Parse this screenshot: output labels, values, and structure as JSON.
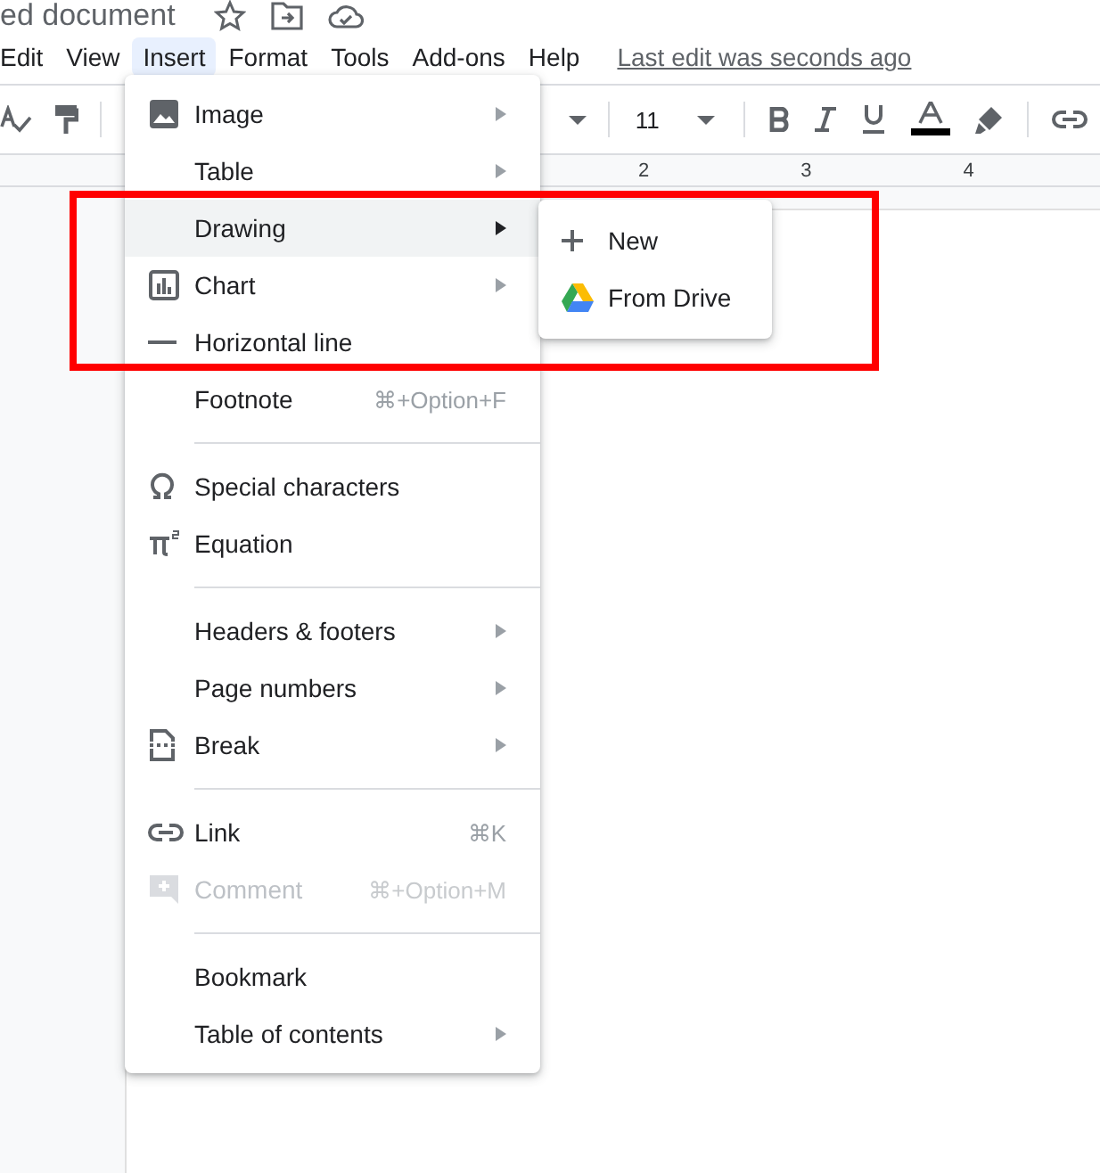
{
  "document_title": "ed document",
  "menu_bar": [
    {
      "label": "Edit",
      "selected": false
    },
    {
      "label": "View",
      "selected": false
    },
    {
      "label": "Insert",
      "selected": true
    },
    {
      "label": "Format",
      "selected": false
    },
    {
      "label": "Tools",
      "selected": false
    },
    {
      "label": "Add-ons",
      "selected": false
    },
    {
      "label": "Help",
      "selected": false
    }
  ],
  "last_edit": "Last edit was seconds ago",
  "toolbar": {
    "font_size": "11"
  },
  "ruler": [
    "2",
    "3",
    "4"
  ],
  "insert_menu": [
    {
      "kind": "image",
      "label": "Image",
      "submenu": true,
      "selected": false,
      "disabled": false
    },
    {
      "kind": "plain",
      "label": "Table",
      "submenu": true,
      "selected": false,
      "disabled": false
    },
    {
      "kind": "plain",
      "label": "Drawing",
      "submenu": true,
      "selected": true,
      "disabled": false
    },
    {
      "kind": "chart",
      "label": "Chart",
      "submenu": true,
      "selected": false,
      "disabled": false
    },
    {
      "kind": "line",
      "label": "Horizontal line",
      "submenu": false,
      "selected": false,
      "disabled": false
    },
    {
      "kind": "plain",
      "label": "Footnote",
      "shortcut": "⌘+Option+F",
      "submenu": false,
      "selected": false,
      "disabled": false
    },
    {
      "kind": "separator"
    },
    {
      "kind": "omega",
      "label": "Special characters",
      "submenu": false,
      "selected": false,
      "disabled": false
    },
    {
      "kind": "pi",
      "label": "Equation",
      "submenu": false,
      "selected": false,
      "disabled": false
    },
    {
      "kind": "separator"
    },
    {
      "kind": "plain",
      "label": "Headers & footers",
      "submenu": true,
      "selected": false,
      "disabled": false
    },
    {
      "kind": "plain",
      "label": "Page numbers",
      "submenu": true,
      "selected": false,
      "disabled": false
    },
    {
      "kind": "break",
      "label": "Break",
      "submenu": true,
      "selected": false,
      "disabled": false
    },
    {
      "kind": "separator"
    },
    {
      "kind": "link",
      "label": "Link",
      "shortcut": "⌘K",
      "submenu": false,
      "selected": false,
      "disabled": false
    },
    {
      "kind": "comment",
      "label": "Comment",
      "shortcut": "⌘+Option+M",
      "submenu": false,
      "selected": false,
      "disabled": true
    },
    {
      "kind": "separator"
    },
    {
      "kind": "plain",
      "label": "Bookmark",
      "submenu": false,
      "selected": false,
      "disabled": false
    },
    {
      "kind": "plain",
      "label": "Table of contents",
      "submenu": true,
      "selected": false,
      "disabled": false
    }
  ],
  "drawing_submenu": [
    {
      "kind": "plus",
      "label": "New"
    },
    {
      "kind": "drive",
      "label": "From Drive"
    }
  ]
}
